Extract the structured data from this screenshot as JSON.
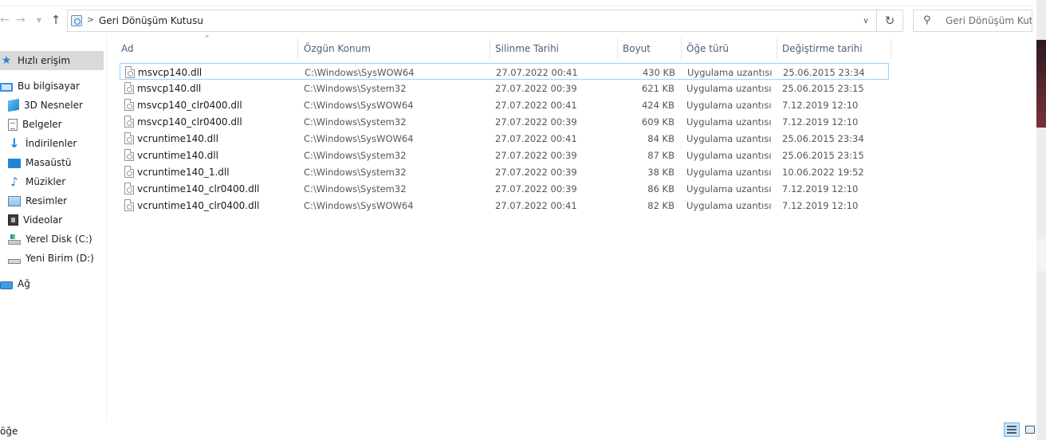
{
  "nav": {
    "back_icon": "arrow-left-icon",
    "forward_icon": "arrow-right-icon",
    "up_icon": "arrow-up-icon",
    "path_separator": ">",
    "address": "Geri Dönüşüm Kutusu",
    "search_placeholder": "Geri Dönüşüm Kut..."
  },
  "sidebar": {
    "items": [
      {
        "label": "Hızlı erişim",
        "icon": "star-icon"
      },
      {
        "label": "Bu bilgisayar",
        "icon": "computer-icon"
      },
      {
        "label": "3D Nesneler",
        "icon": "cube-icon"
      },
      {
        "label": "Belgeler",
        "icon": "document-icon"
      },
      {
        "label": "İndirilenler",
        "icon": "download-icon"
      },
      {
        "label": "Masaüstü",
        "icon": "desktop-icon"
      },
      {
        "label": "Müzikler",
        "icon": "music-icon"
      },
      {
        "label": "Resimler",
        "icon": "picture-icon"
      },
      {
        "label": "Videolar",
        "icon": "video-icon"
      },
      {
        "label": "Yerel Disk (C:)",
        "icon": "disk-icon"
      },
      {
        "label": "Yeni Birim (D:)",
        "icon": "drive-icon"
      },
      {
        "label": "Ağ",
        "icon": "network-icon"
      }
    ]
  },
  "columns": {
    "name": "Ad",
    "location": "Özgün Konum",
    "deleted": "Silinme Tarihi",
    "size": "Boyut",
    "type": "Öğe türü",
    "modified": "Değiştirme tarihi"
  },
  "files": [
    {
      "name": "msvcp140.dll",
      "location": "C:\\Windows\\SysWOW64",
      "deleted": "27.07.2022 00:41",
      "size": "430 KB",
      "type": "Uygulama uzantısı",
      "modified": "25.06.2015 23:34"
    },
    {
      "name": "msvcp140.dll",
      "location": "C:\\Windows\\System32",
      "deleted": "27.07.2022 00:39",
      "size": "621 KB",
      "type": "Uygulama uzantısı",
      "modified": "25.06.2015 23:15"
    },
    {
      "name": "msvcp140_clr0400.dll",
      "location": "C:\\Windows\\SysWOW64",
      "deleted": "27.07.2022 00:41",
      "size": "424 KB",
      "type": "Uygulama uzantısı",
      "modified": "7.12.2019 12:10"
    },
    {
      "name": "msvcp140_clr0400.dll",
      "location": "C:\\Windows\\System32",
      "deleted": "27.07.2022 00:39",
      "size": "609 KB",
      "type": "Uygulama uzantısı",
      "modified": "7.12.2019 12:10"
    },
    {
      "name": "vcruntime140.dll",
      "location": "C:\\Windows\\SysWOW64",
      "deleted": "27.07.2022 00:41",
      "size": "84 KB",
      "type": "Uygulama uzantısı",
      "modified": "25.06.2015 23:34"
    },
    {
      "name": "vcruntime140.dll",
      "location": "C:\\Windows\\System32",
      "deleted": "27.07.2022 00:39",
      "size": "87 KB",
      "type": "Uygulama uzantısı",
      "modified": "25.06.2015 23:15"
    },
    {
      "name": "vcruntime140_1.dll",
      "location": "C:\\Windows\\System32",
      "deleted": "27.07.2022 00:39",
      "size": "38 KB",
      "type": "Uygulama uzantısı",
      "modified": "10.06.2022 19:52"
    },
    {
      "name": "vcruntime140_clr0400.dll",
      "location": "C:\\Windows\\System32",
      "deleted": "27.07.2022 00:39",
      "size": "86 KB",
      "type": "Uygulama uzantısı",
      "modified": "7.12.2019 12:10"
    },
    {
      "name": "vcruntime140_clr0400.dll",
      "location": "C:\\Windows\\SysWOW64",
      "deleted": "27.07.2022 00:41",
      "size": "82 KB",
      "type": "Uygulama uzantısı",
      "modified": "7.12.2019 12:10"
    }
  ],
  "status": {
    "text": "öğe"
  }
}
